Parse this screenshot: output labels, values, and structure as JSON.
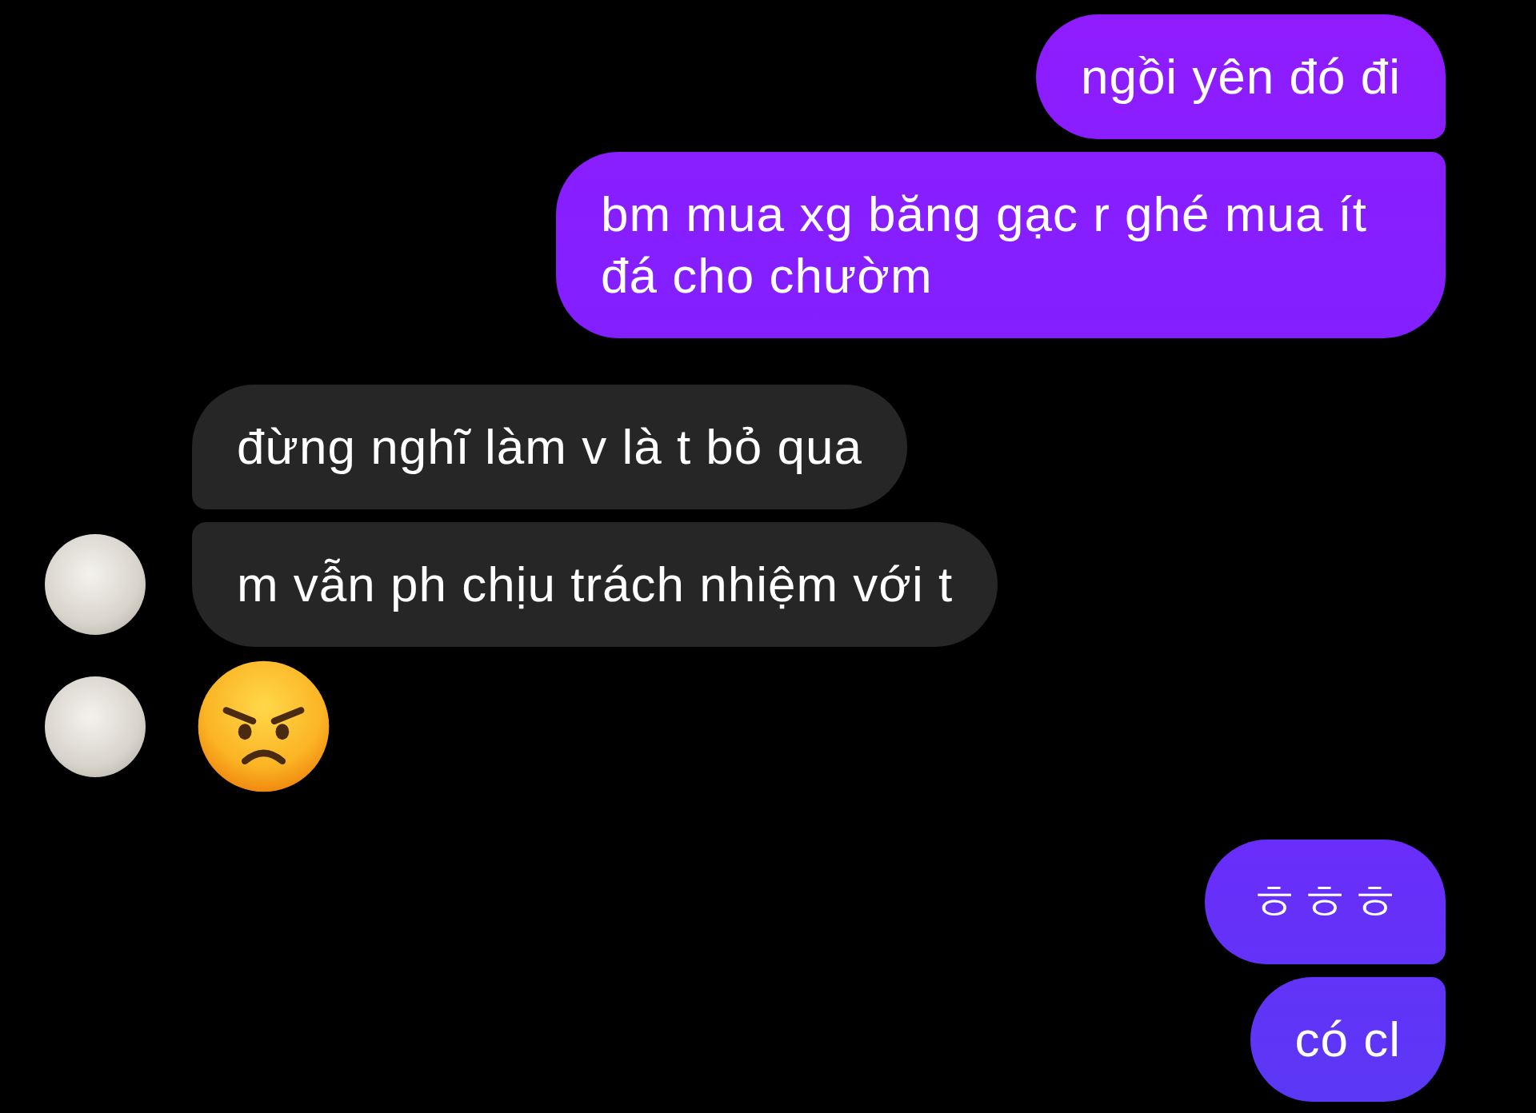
{
  "messages": [
    {
      "kind": "sent",
      "text": "ngồi yên đó đi"
    },
    {
      "kind": "sent",
      "text": "bm mua xg băng gạc r ghé mua ít đá cho chườm"
    },
    {
      "kind": "received",
      "text": "đừng nghĩ làm v là t bỏ qua",
      "avatar": false
    },
    {
      "kind": "received",
      "text": "m vẫn ph chịu trách nhiệm với t",
      "avatar": true
    },
    {
      "kind": "emoji",
      "avatar": true
    },
    {
      "kind": "sent",
      "text": "ㅎㅎㅎ"
    },
    {
      "kind": "sent",
      "text": "có cl"
    }
  ]
}
